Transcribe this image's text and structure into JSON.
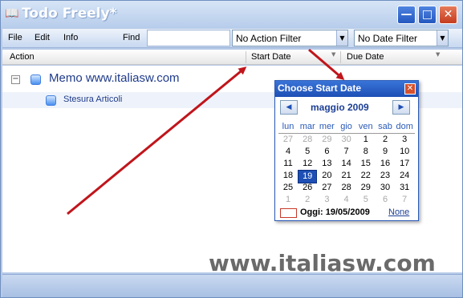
{
  "window": {
    "title": "Todo Freely*",
    "controls": {
      "minimize": "—",
      "maximize": "□",
      "close": "✕"
    }
  },
  "menu": {
    "file": "File",
    "edit": "Edit",
    "info": "Info",
    "find": "Find",
    "find_value": ""
  },
  "filters": {
    "action_filter": "No Action Filter",
    "date_filter": "No Date Filter"
  },
  "columns": {
    "action": "Action",
    "start_date": "Start Date",
    "due_date": "Due Date"
  },
  "tree": {
    "expander": "−",
    "items": [
      {
        "label": "Memo www.italiasw.com"
      },
      {
        "label": "Stesura Articoli"
      }
    ]
  },
  "calendar": {
    "title": "Choose Start Date",
    "close": "✕",
    "prev": "◀",
    "next": "▶",
    "month_label": "maggio 2009",
    "weekdays": [
      "lun",
      "mar",
      "mer",
      "gio",
      "ven",
      "sab",
      "dom"
    ],
    "weeks": [
      [
        "27",
        "28",
        "29",
        "30",
        "1",
        "2",
        "3"
      ],
      [
        "4",
        "5",
        "6",
        "7",
        "8",
        "9",
        "10"
      ],
      [
        "11",
        "12",
        "13",
        "14",
        "15",
        "16",
        "17"
      ],
      [
        "18",
        "19",
        "20",
        "21",
        "22",
        "23",
        "24"
      ],
      [
        "25",
        "26",
        "27",
        "28",
        "29",
        "30",
        "31"
      ],
      [
        "1",
        "2",
        "3",
        "4",
        "5",
        "6",
        "7"
      ]
    ],
    "selected_day": "19",
    "today_label": "Oggi: 19/05/2009",
    "none_label": "None"
  },
  "watermark": "www.italiasw.com",
  "colors": {
    "arrow": "#c0151b",
    "title_blue": "#1d4fb5",
    "selected_day": "#1d4fb5"
  }
}
